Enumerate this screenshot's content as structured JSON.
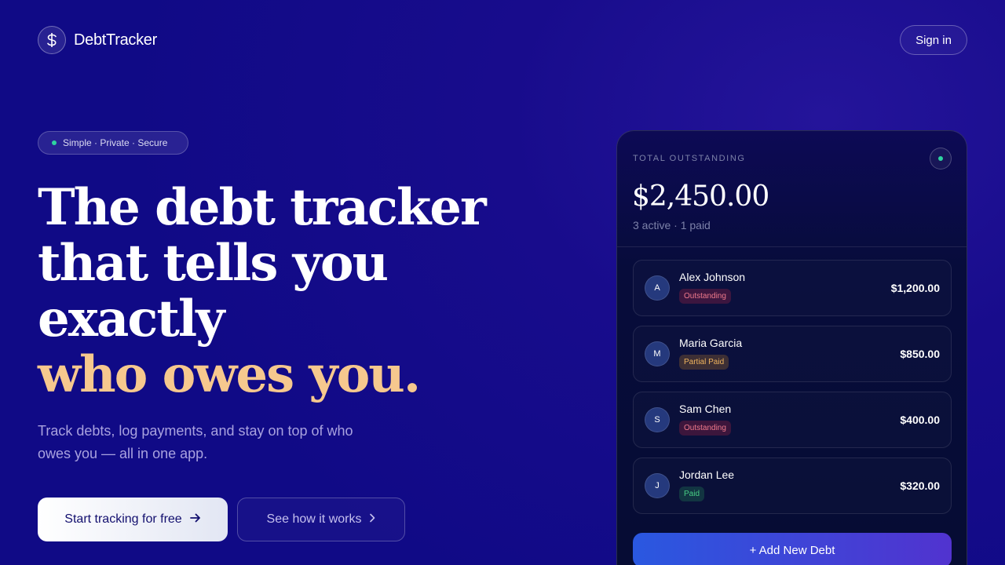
{
  "app": {
    "name": "DebtTracker",
    "logo_icon": "dollar-sign-icon"
  },
  "header": {
    "signin_label": "Sign in"
  },
  "hero": {
    "tagline": "Simple · Private · Secure",
    "headline_lines": [
      "The debt tracker",
      "that tells you",
      "exactly"
    ],
    "headline_accent": "who owes you.",
    "subtext": "Track debts, log payments, and stay on top of who owes you — all in one app.",
    "primary_cta": "Start tracking for free",
    "secondary_cta": "See how it works"
  },
  "card": {
    "label": "TOTAL OUTSTANDING",
    "total": "$2,450.00",
    "summary": "3 active · 1 paid",
    "debts": [
      {
        "initial": "A",
        "name": "Alex Johnson",
        "status": "Outstanding",
        "amount": "$1,200.00"
      },
      {
        "initial": "M",
        "name": "Maria Garcia",
        "status": "Partial Paid",
        "amount": "$850.00"
      },
      {
        "initial": "S",
        "name": "Sam Chen",
        "status": "Outstanding",
        "amount": "$400.00"
      },
      {
        "initial": "J",
        "name": "Jordan Lee",
        "status": "Paid",
        "amount": "$320.00"
      }
    ],
    "add_label": "+ Add New Debt"
  },
  "colors": {
    "background": "#100a86",
    "accent_text": "#f6c88e",
    "status_dot": "#2ed3a0",
    "outstanding": "#f07a8c",
    "partial": "#f0b45e",
    "paid": "#48cf84",
    "add_button_start": "#2a58e0",
    "add_button_end": "#5133cf"
  }
}
